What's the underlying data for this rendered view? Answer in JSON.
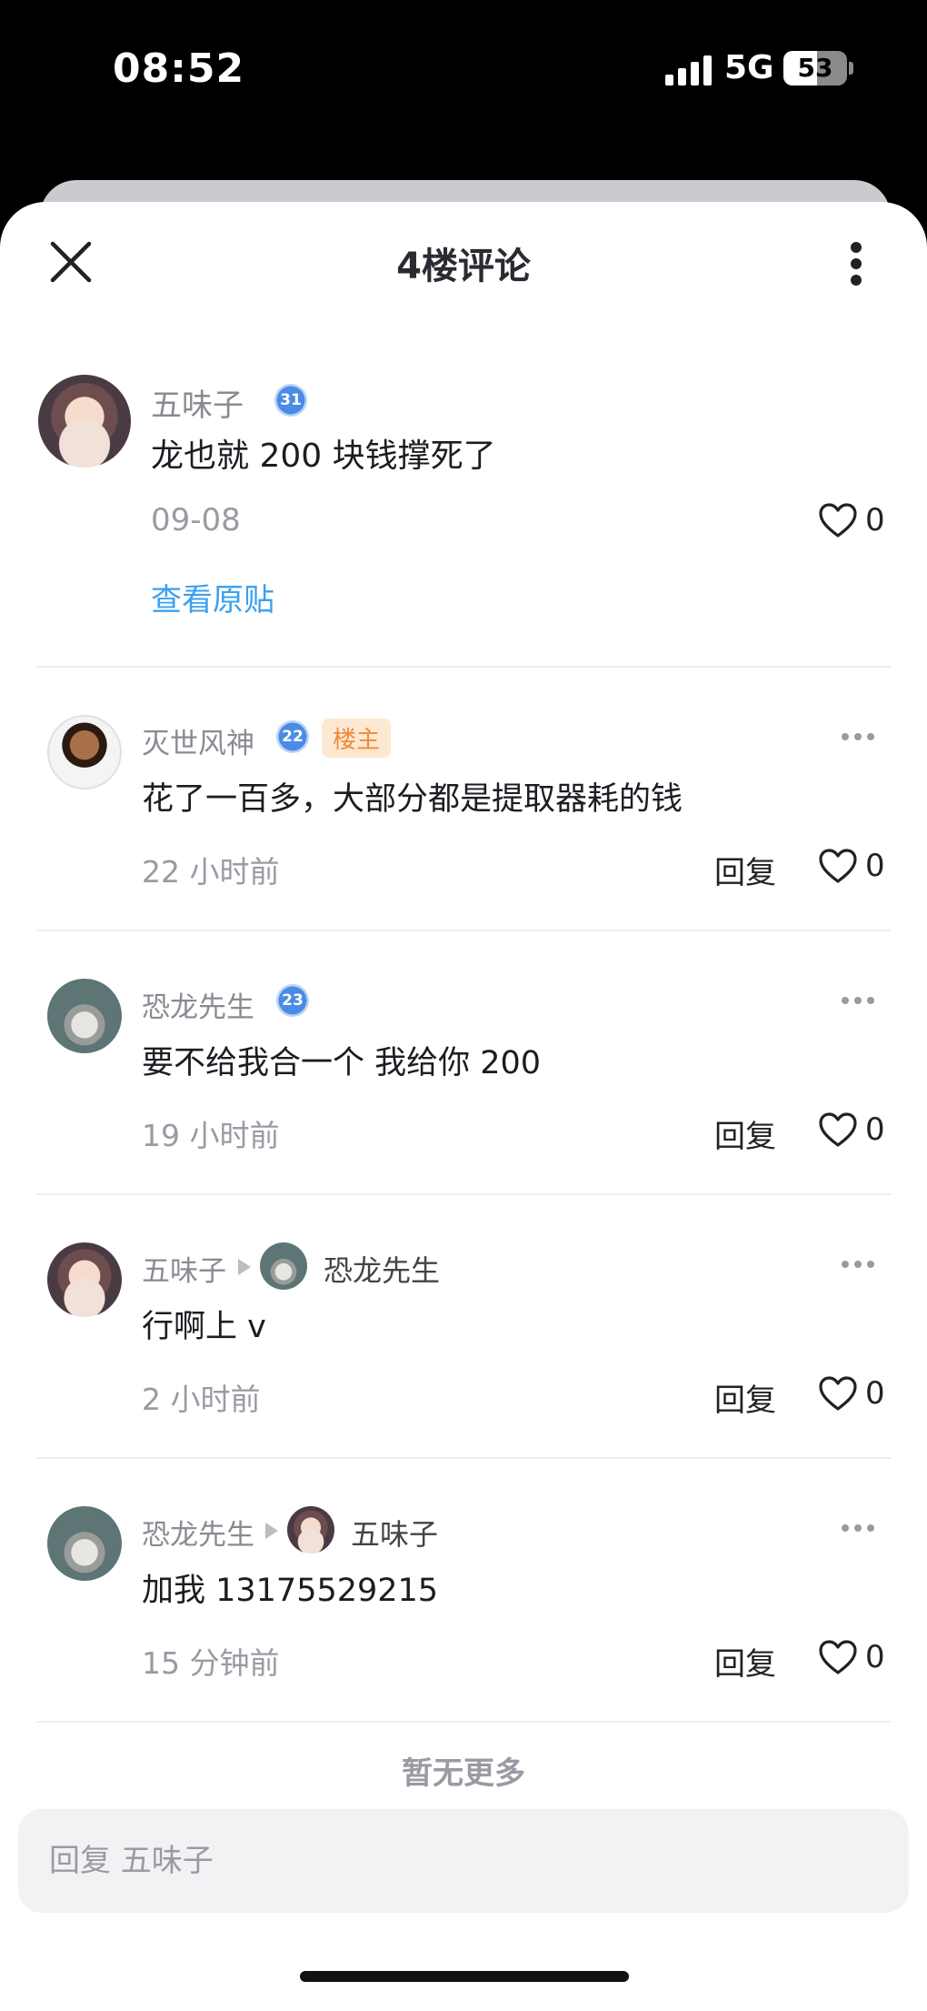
{
  "status": {
    "time": "08:52",
    "network": "5G",
    "battery": "53",
    "battery_level": 0.53
  },
  "header": {
    "title": "4楼评论"
  },
  "original": {
    "name": "五味子",
    "level": "31",
    "content": "龙也就 200 块钱撑死了",
    "date": "09-08",
    "likes": "0",
    "view_original": "查看原贴"
  },
  "comments": [
    {
      "name": "灭世风神",
      "level": "22",
      "badge": "楼主",
      "content": "花了一百多，大部分都是提取器耗的钱",
      "time": "22 小时前",
      "reply": "回复",
      "likes": "0"
    },
    {
      "name": "恐龙先生",
      "level": "23",
      "content": "要不给我合一个 我给你 200",
      "time": "19 小时前",
      "reply": "回复",
      "likes": "0"
    },
    {
      "name": "五味子",
      "reply_to": "恐龙先生",
      "content": "行啊上 v",
      "time": "2 小时前",
      "reply": "回复",
      "likes": "0"
    },
    {
      "name": "恐龙先生",
      "reply_to": "五味子",
      "content": "加我 13175529215",
      "time": "15 分钟前",
      "reply": "回复",
      "likes": "0"
    }
  ],
  "footer": {
    "no_more": "暂无更多",
    "input_placeholder": "回复 五味子"
  },
  "colors": {
    "link": "#3aa0ef",
    "badge_bg": "#fde8d2",
    "badge_text": "#f08a3a",
    "level": "#4a8be6"
  }
}
